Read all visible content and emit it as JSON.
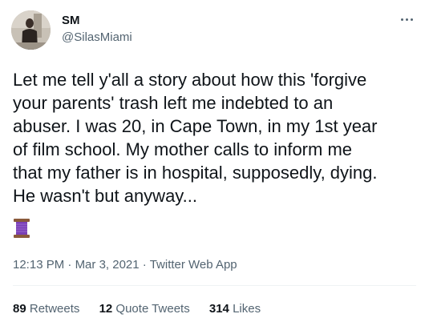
{
  "author": {
    "name": "SM",
    "handle": "@SilasMiami"
  },
  "tweet": {
    "text": "Let me tell y'all a story about how this 'forgive\nyour parents' trash left me indebted to an\nabuser. I was 20, in Cape Town, in my 1st year\nof film school. My mother calls to inform me\nthat my father is in hospital, supposedly, dying.\nHe wasn't but anyway...",
    "emoji_icon": "thread-spool-icon",
    "time": "12:13 PM",
    "date": "Mar 3, 2021",
    "source": "Twitter Web App",
    "separator": "·"
  },
  "stats": {
    "retweets_count": "89",
    "retweets_label": "Retweets",
    "quotes_count": "12",
    "quotes_label": "Quote Tweets",
    "likes_count": "314",
    "likes_label": "Likes"
  },
  "colors": {
    "text": "#0f1419",
    "secondary": "#536471",
    "divider": "#eff3f4",
    "spool": "#7a3fb5"
  }
}
